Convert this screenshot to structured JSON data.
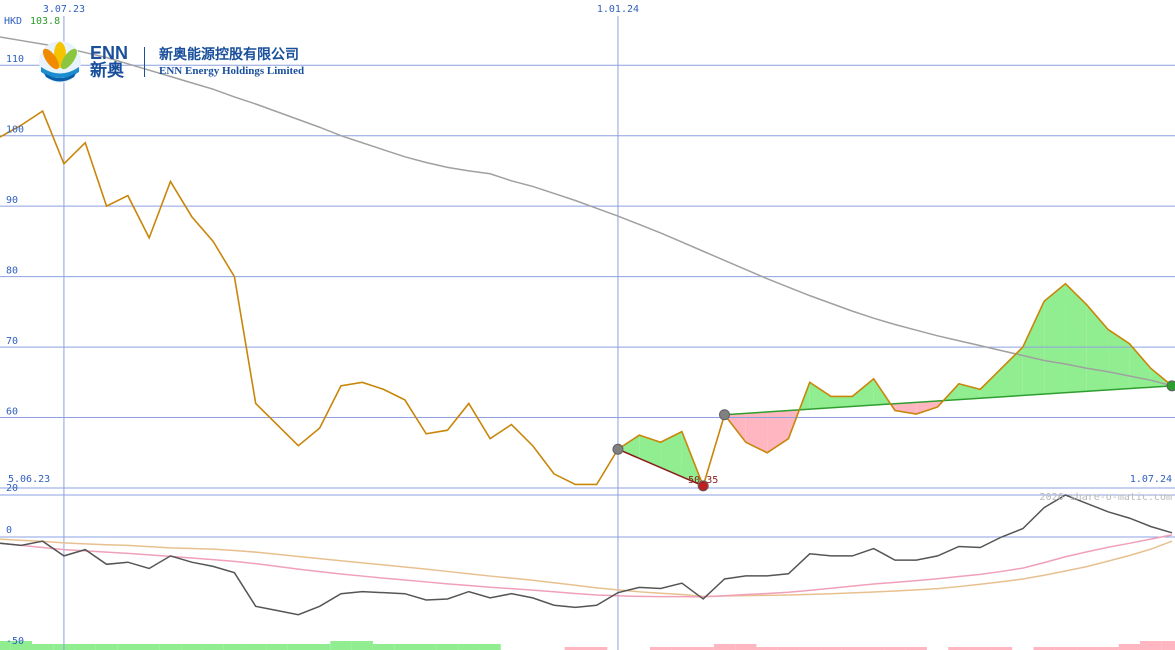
{
  "header": {
    "currency": "HKD",
    "last_price": "103.8",
    "watermark": "2026 share-o-matic.com"
  },
  "logo": {
    "en_short": "ENN",
    "zh_short": "新奥",
    "zh_name": "新奥能源控股有限公司",
    "en_name": "ENN Energy Holdings Limited"
  },
  "colors": {
    "price": "#c8860a",
    "ma": "#a0a0a0",
    "grid": "#8ea0e0",
    "up_fill": "#90ee90",
    "down_fill": "#ffb6c1",
    "trend_down": "#8b1a1a",
    "trend_up": "#2e9e2e",
    "osc": "#555555",
    "osc_pink": "#f0a0b8",
    "osc_tan": "#e8c090"
  },
  "chart_data": [
    {
      "type": "line",
      "panel": "price",
      "unit": "HKD",
      "ylim": [
        50,
        115
      ],
      "y_ticks": [
        "110",
        "100",
        "90",
        "80",
        "70",
        "60"
      ],
      "x_tick_labels": [
        {
          "label": "3.07.23",
          "index": 3
        },
        {
          "label": "1.01.24",
          "index": 29
        },
        {
          "label": "5.06.23",
          "index": 0,
          "lower": true
        },
        {
          "label": "1.07.24",
          "index": 55,
          "lower": true
        }
      ],
      "x": [
        "5.06.23",
        "",
        "",
        "3.07.23",
        "",
        "",
        "",
        "",
        "",
        "",
        "",
        "",
        "",
        "",
        "",
        "",
        "",
        "",
        "",
        "",
        "",
        "",
        "",
        "",
        "",
        "",
        "",
        "",
        "",
        "1.01.24",
        "",
        "",
        "",
        "",
        "",
        "",
        "",
        "",
        "",
        "",
        "",
        "",
        "",
        "",
        "",
        "",
        "",
        "",
        "",
        "",
        "",
        "",
        "",
        "",
        "",
        "1.07.24"
      ],
      "series": [
        {
          "role": "price",
          "values": [
            99.8,
            101.5,
            103.5,
            96.0,
            99.0,
            90.0,
            91.5,
            85.5,
            93.5,
            88.5,
            85.0,
            80.0,
            62.0,
            59.0,
            56.0,
            58.5,
            64.5,
            65.0,
            64.0,
            62.5,
            57.7,
            58.2,
            62.0,
            57.0,
            59.0,
            56.0,
            52.0,
            50.5,
            50.5,
            55.5,
            57.5,
            56.5,
            58.0,
            50.3,
            60.4,
            56.5,
            55.0,
            57.0,
            65.0,
            63.0,
            63.0,
            65.5,
            61.0,
            60.5,
            61.5,
            64.8,
            64.0,
            67.0,
            70.0,
            76.5,
            79.0,
            76.0,
            72.5,
            70.5,
            67.0,
            64.5
          ]
        },
        {
          "role": "moving-average",
          "values": [
            114.0,
            113.5,
            113.0,
            112.5,
            111.8,
            111.1,
            110.2,
            109.3,
            108.4,
            107.5,
            106.6,
            105.5,
            104.5,
            103.4,
            102.3,
            101.2,
            100.0,
            99.0,
            98.0,
            97.0,
            96.2,
            95.5,
            95.0,
            94.6,
            93.6,
            92.8,
            91.8,
            90.8,
            89.7,
            88.6,
            87.4,
            86.2,
            84.9,
            83.6,
            82.3,
            81.0,
            79.7,
            78.5,
            77.3,
            76.2,
            75.1,
            74.1,
            73.2,
            72.4,
            71.6,
            70.9,
            70.2,
            69.5,
            68.8,
            68.1,
            67.6,
            67.0,
            66.5,
            65.9,
            65.3,
            64.5
          ]
        }
      ],
      "markers": [
        {
          "index": 29,
          "value": 55.5,
          "kind": "pivot"
        },
        {
          "index": 33,
          "value": 50.3,
          "kind": "low",
          "label": "50.35"
        },
        {
          "index": 34,
          "value": 60.4,
          "kind": "pivot"
        },
        {
          "index": 55,
          "value": 64.5,
          "kind": "last"
        }
      ],
      "trendlines": [
        {
          "from": 29,
          "to": 33,
          "direction": "down"
        },
        {
          "from": 34,
          "to": 55,
          "direction": "up"
        }
      ]
    },
    {
      "type": "line",
      "panel": "oscillator",
      "ylim": [
        -50,
        20
      ],
      "y_ticks": [
        "20",
        "0",
        "-50"
      ],
      "series": [
        {
          "role": "oscillator",
          "values": [
            -3,
            -4,
            -2,
            -9,
            -6,
            -13,
            -12,
            -15,
            -9,
            -12,
            -14,
            -17,
            -33,
            -35,
            -37,
            -33,
            -27,
            -26,
            -26.5,
            -27,
            -30,
            -29.5,
            -26,
            -29,
            -27,
            -29,
            -32.5,
            -33.5,
            -32.5,
            -26.5,
            -24,
            -24.5,
            -22,
            -29.5,
            -20,
            -18.5,
            -18.5,
            -17.5,
            -8,
            -9,
            -9,
            -5.5,
            -11,
            -11,
            -9,
            -4.5,
            -5,
            0,
            4,
            14,
            20,
            16,
            12,
            9,
            5,
            2
          ]
        },
        {
          "role": "signal-fast",
          "values": [
            -3,
            -4,
            -5,
            -6,
            -6.6,
            -7.2,
            -7.8,
            -8.5,
            -9.2,
            -10,
            -10.8,
            -11.6,
            -12.7,
            -14,
            -15.3,
            -16.5,
            -17.6,
            -18.6,
            -19.6,
            -20.5,
            -21.4,
            -22.3,
            -23.1,
            -23.9,
            -24.6,
            -25.3,
            -26.1,
            -26.9,
            -27.6,
            -28,
            -28.3,
            -28.4,
            -28.4,
            -28.5,
            -28,
            -27.4,
            -26.9,
            -26.3,
            -25.4,
            -24.4,
            -23.4,
            -22.4,
            -21.6,
            -20.8,
            -19.9,
            -18.8,
            -17.8,
            -16.4,
            -14.8,
            -12.2,
            -9.4,
            -7.1,
            -4.9,
            -3,
            -1,
            1
          ]
        },
        {
          "role": "signal-slow",
          "values": [
            -1,
            -1.6,
            -2.1,
            -2.8,
            -3.3,
            -3.7,
            -4,
            -4.6,
            -5.2,
            -5.5,
            -5.8,
            -6.4,
            -7.2,
            -8.2,
            -9.3,
            -10.3,
            -11.3,
            -12.3,
            -13.3,
            -14.3,
            -15.3,
            -16.4,
            -17.5,
            -18.6,
            -19.6,
            -20.6,
            -21.8,
            -23,
            -24.2,
            -25.2,
            -26.1,
            -26.8,
            -27.4,
            -28.3,
            -28.1,
            -27.9,
            -27.8,
            -27.6,
            -27.3,
            -27,
            -26.6,
            -26.2,
            -25.7,
            -25.2,
            -24.6,
            -23.6,
            -22.5,
            -21.3,
            -20,
            -18.2,
            -16.2,
            -14.1,
            -11.5,
            -8.8,
            -5.8,
            -2
          ]
        }
      ],
      "histogram": [
        3,
        3,
        2,
        2,
        2,
        2,
        2,
        2,
        2,
        2,
        2,
        2,
        2,
        2,
        2,
        2,
        3,
        3,
        2,
        2,
        2,
        2,
        2,
        2,
        0,
        0,
        0,
        -1,
        -1,
        0,
        0,
        -1,
        -1,
        -1,
        -2,
        -2,
        -1,
        -1,
        -1,
        -1,
        -1,
        -1,
        -1,
        -1,
        0,
        -1,
        -1,
        -1,
        0,
        -1,
        -1,
        -1,
        -1,
        -2,
        -3,
        -3
      ]
    }
  ]
}
